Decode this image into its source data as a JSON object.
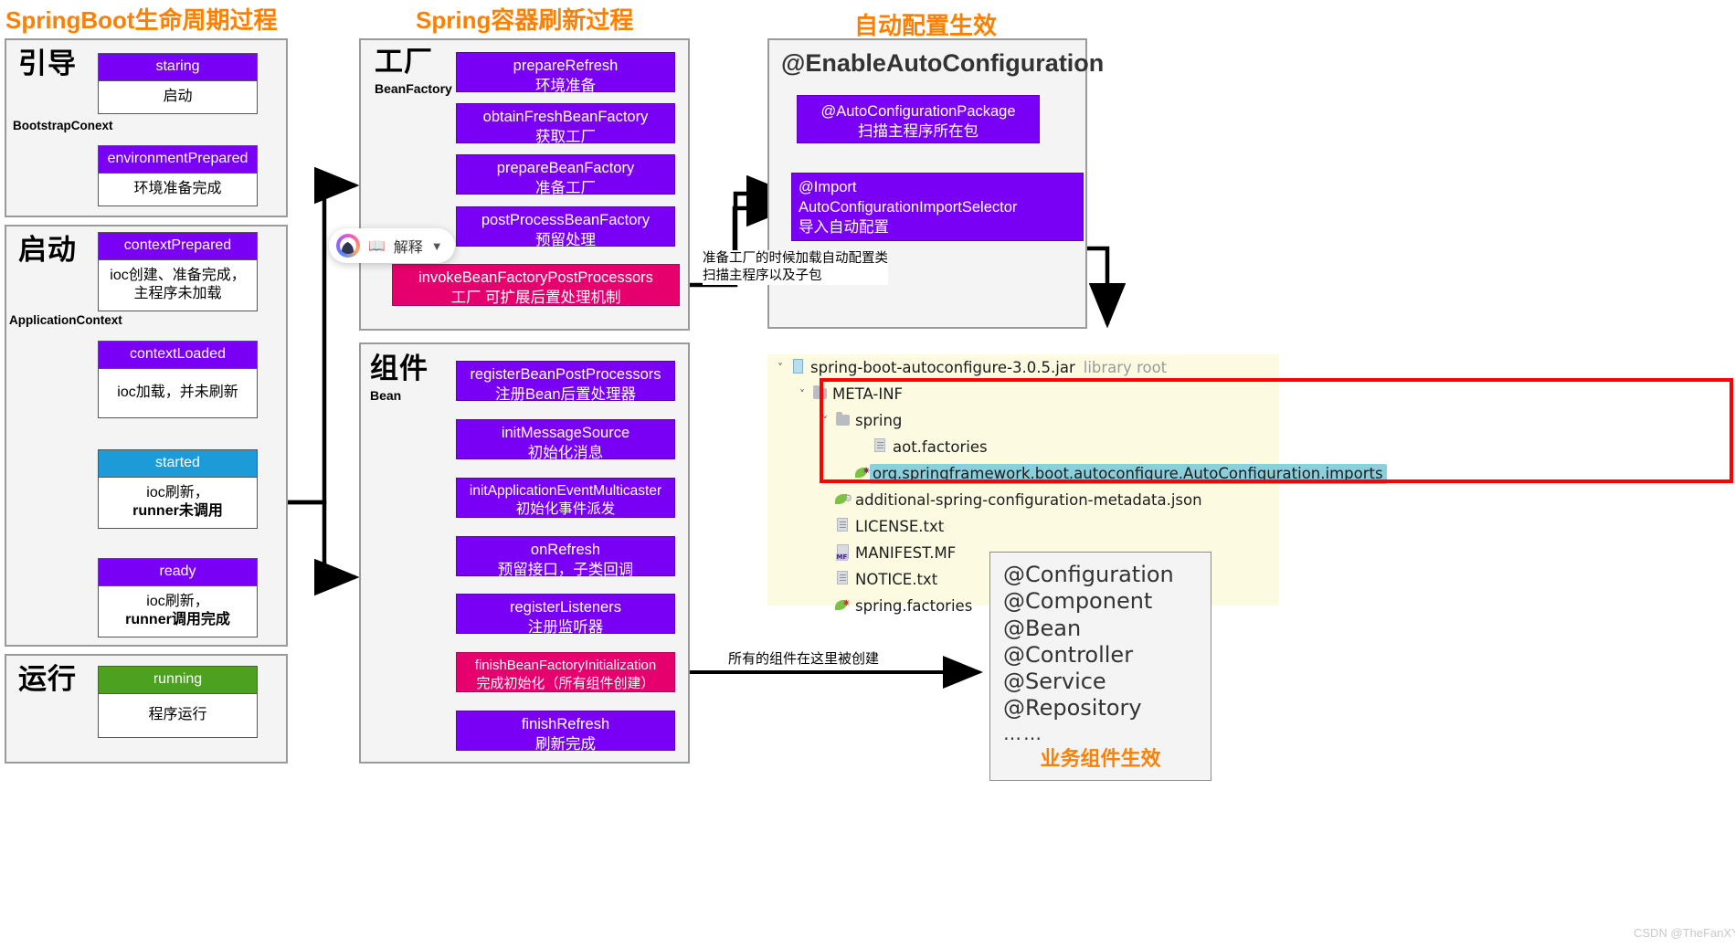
{
  "titles": {
    "left": "SpringBoot生命周期过程",
    "middle": "Spring容器刷新过程",
    "right": "自动配置生效"
  },
  "left_column": {
    "panels": [
      {
        "label_cjk": "引导",
        "sub": "BootstrapConext",
        "cards": [
          {
            "head": "staring",
            "head_color": "#7A00F5",
            "body": "启动"
          },
          {
            "head": "environmentPrepared",
            "head_color": "#7A00F5",
            "body": "环境准备完成"
          }
        ]
      },
      {
        "label_cjk": "启动",
        "sub": "ApplicationContext",
        "cards": [
          {
            "head": "contextPrepared",
            "head_color": "#7A00F5",
            "body_line1": "ioc创建、准备完成，",
            "body_line2": "主程序未加载"
          },
          {
            "head": "contextLoaded",
            "head_color": "#7A00F5",
            "body": "ioc加载，并未刷新"
          },
          {
            "head": "started",
            "head_color": "#1C9BD8",
            "body_line1": "ioc刷新，",
            "body_line2": "runner未调用"
          },
          {
            "head": "ready",
            "head_color": "#7A00F5",
            "body_line1": "ioc刷新，",
            "body_line2": "runner调用完成"
          }
        ]
      },
      {
        "label_cjk": "运行",
        "sub": "",
        "cards": [
          {
            "head": "running",
            "head_color": "#4CA121",
            "body": "程序运行"
          }
        ]
      }
    ]
  },
  "middle_column": {
    "factory_panel": {
      "label_cjk": "工厂",
      "sub": "BeanFactory",
      "steps": [
        {
          "en": "prepareRefresh",
          "cn": "环境准备",
          "color": "#7A00F5"
        },
        {
          "en": "obtainFreshBeanFactory",
          "cn": "获取工厂",
          "color": "#7A00F5"
        },
        {
          "en": "prepareBeanFactory",
          "cn": "准备工厂",
          "color": "#7A00F5"
        },
        {
          "en": "postProcessBeanFactory",
          "cn": "预留处理",
          "color": "#7A00F5"
        },
        {
          "en": "invokeBeanFactoryPostProcessors",
          "cn": "工厂 可扩展后置处理机制",
          "color": "#E5006E"
        }
      ]
    },
    "bean_panel": {
      "label_cjk": "组件",
      "sub": "Bean",
      "steps": [
        {
          "en": "registerBeanPostProcessors",
          "cn": "注册Bean后置处理器",
          "color": "#7A00F5"
        },
        {
          "en": "initMessageSource",
          "cn": "初始化消息",
          "color": "#7A00F5"
        },
        {
          "en": "initApplicationEventMulticaster",
          "cn": "初始化事件派发",
          "color": "#7A00F5"
        },
        {
          "en": "onRefresh",
          "cn": "预留接口，子类回调",
          "color": "#7A00F5"
        },
        {
          "en": "registerListeners",
          "cn": "注册监听器",
          "color": "#7A00F5"
        },
        {
          "en": "finishBeanFactoryInitialization",
          "cn": "完成初始化（所有组件创建）",
          "color": "#E5006E"
        },
        {
          "en": "finishRefresh",
          "cn": "刷新完成",
          "color": "#7A00F5"
        }
      ]
    }
  },
  "right_column": {
    "panel_title": "@EnableAutoConfiguration",
    "steps": [
      {
        "en": "@AutoConfigurationPackage",
        "cn": "扫描主程序所在包",
        "color": "#7A00F5",
        "align": "center"
      },
      {
        "en_line1": "@Import",
        "en_line2": "AutoConfigurationImportSelector",
        "cn": "导入自动配置",
        "color": "#7A00F5",
        "align": "left"
      }
    ]
  },
  "annotations": {
    "prepare_factory_line1": "准备工厂的时候加载自动配置类",
    "prepare_factory_line2": "扫描主程序以及子包",
    "components_created": "所有的组件在这里被创建"
  },
  "file_tree": {
    "rows": [
      {
        "indent": 0,
        "caret": "v",
        "icon": "jar-icon",
        "name": "spring-boot-autoconfigure-3.0.5.jar",
        "hint": "library root",
        "selected": false
      },
      {
        "indent": 1,
        "caret": "v",
        "icon": "folder-icon",
        "name": "META-INF",
        "hint": "",
        "selected": false
      },
      {
        "indent": 2,
        "caret": "v",
        "icon": "folder-icon",
        "name": "spring",
        "hint": "",
        "selected": false
      },
      {
        "indent": 3,
        "caret": "",
        "icon": "file-icon",
        "name": "aot.factories",
        "hint": "",
        "selected": false
      },
      {
        "indent": 3,
        "caret": "",
        "icon": "spring-leaf-icon",
        "name": "org.springframework.boot.autoconfigure.AutoConfiguration.imports",
        "hint": "",
        "selected": true
      },
      {
        "indent": 2,
        "caret": "",
        "icon": "metadata-icon",
        "name": "additional-spring-configuration-metadata.json",
        "hint": "",
        "selected": false
      },
      {
        "indent": 2,
        "caret": "",
        "icon": "file-icon",
        "name": "LICENSE.txt",
        "hint": "",
        "selected": false
      },
      {
        "indent": 2,
        "caret": "",
        "icon": "manifest-icon",
        "name": "MANIFEST.MF",
        "hint": "",
        "selected": false
      },
      {
        "indent": 2,
        "caret": "",
        "icon": "file-icon",
        "name": "NOTICE.txt",
        "hint": "",
        "selected": false
      },
      {
        "indent": 2,
        "caret": "",
        "icon": "spring-leaf-icon",
        "name": "spring.factories",
        "hint": "",
        "selected": false
      }
    ]
  },
  "annotation_box": {
    "lines": [
      "@Configuration",
      "@Component",
      "@Bean",
      "@Controller",
      "@Service",
      "@Repository",
      "……"
    ],
    "highlight": "业务组件生效"
  },
  "explain_pill": {
    "label": "解释",
    "book_icon": "book-icon",
    "chevron_icon": "chevron-down-icon"
  },
  "watermark": "CSDN @TheFanXY",
  "colors": {
    "accent_orange": "#FF8000",
    "purple": "#7A00F5",
    "pink": "#E5006E",
    "blue": "#1C9BD8",
    "green": "#4CA121",
    "red_highlight": "#FF0000",
    "tree_bg": "#FCFAE0",
    "selected_row": "#8ACFDD"
  }
}
